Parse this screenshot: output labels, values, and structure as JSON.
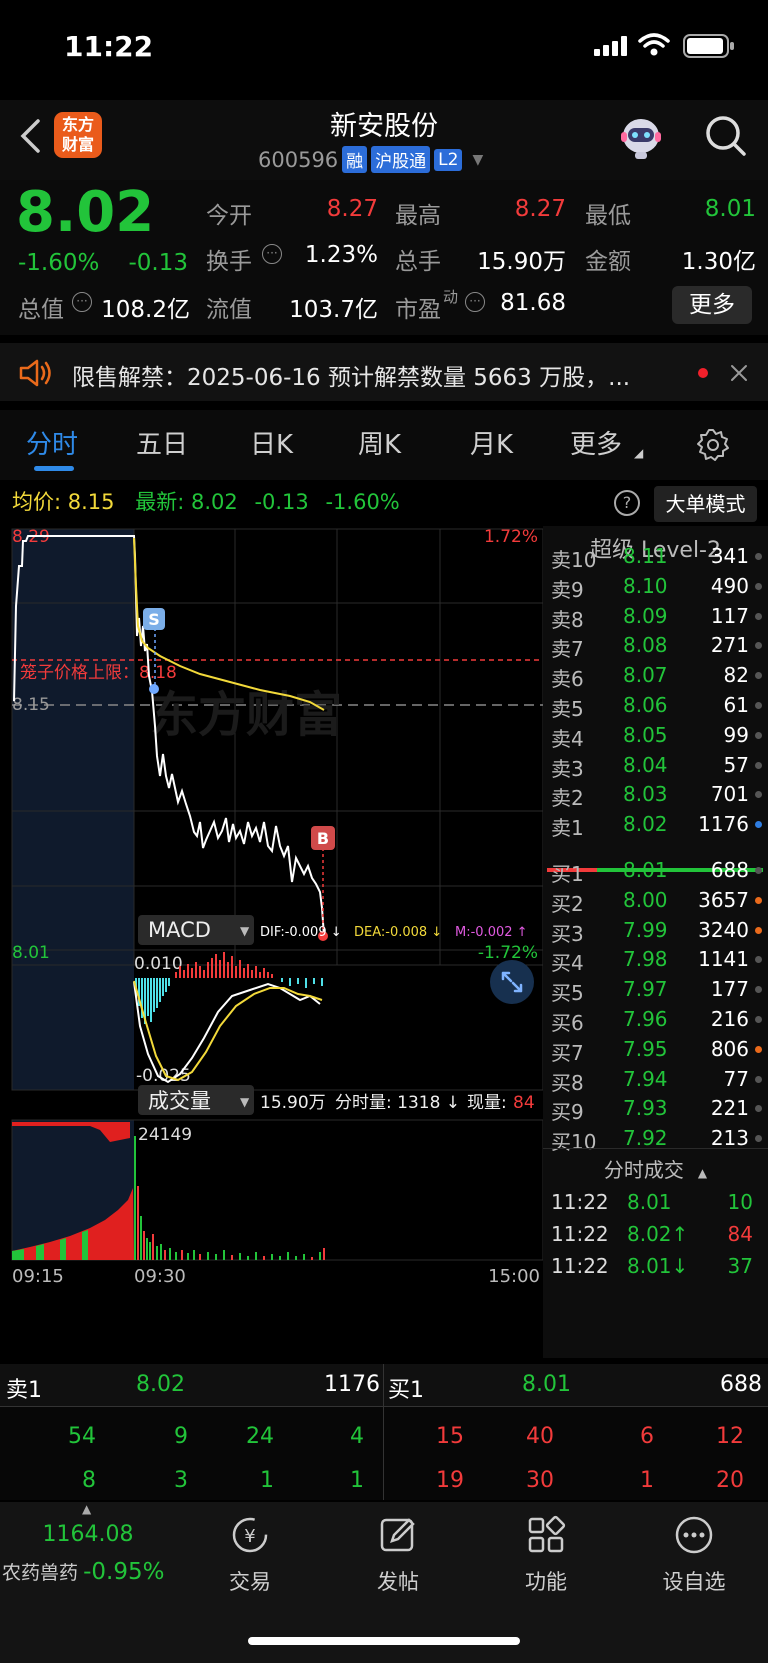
{
  "status_bar": {
    "time": "11:22"
  },
  "header": {
    "logo_line1": "东方",
    "logo_line2": "财富",
    "stock_name": "新安股份",
    "stock_code": "600596",
    "tags": [
      "融",
      "沪股通",
      "L2"
    ]
  },
  "quote": {
    "price": "8.02",
    "change_pct": "-1.60%",
    "change": "-0.13",
    "open_label": "今开",
    "open": "8.27",
    "high_label": "最高",
    "high": "8.27",
    "low_label": "最低",
    "low": "8.01",
    "turnover_label": "换手",
    "turnover": "1.23%",
    "volume_label": "总手",
    "volume": "15.90万",
    "amount_label": "金额",
    "amount": "1.30亿",
    "mktcap_label": "总值",
    "mktcap": "108.2亿",
    "float_label": "流值",
    "float_cap": "103.7亿",
    "pe_label": "市盈",
    "pe_sup": "动",
    "pe": "81.68",
    "more": "更多"
  },
  "notice": {
    "text": "限售解禁：2025-06-16 预计解禁数量 5663 万股，..."
  },
  "tabs": [
    "分时",
    "五日",
    "日K",
    "周K",
    "月K",
    "更多"
  ],
  "price_line": {
    "avg_label": "均价:",
    "avg": "8.15",
    "latest_label": "最新:",
    "latest": "8.02",
    "change": "-0.13",
    "change_pct": "-1.60%",
    "big_order": "大单模式"
  },
  "chart": {
    "y_top": "8.29",
    "y_ref": "8.15",
    "y_bottom": "8.01",
    "pct_top": "1.72%",
    "pct_bottom": "-1.72%",
    "cage_label": "笼子价格上限：8.18",
    "watermark": "东方财富",
    "sell_marker": "S",
    "buy_marker": "B",
    "macd_label": "MACD",
    "dif": "DIF:-0.009 ↓",
    "dea": "DEA:-0.008 ↓",
    "m": "M:-0.002 ↑",
    "macd_top": "0.010",
    "macd_bottom": "-0.025",
    "vol_label": "成交量",
    "vol_total": "15.90万",
    "vol_minute": "分时量: 1318 ↓",
    "vol_now_label": "现量:",
    "vol_now": "84",
    "vol_max": "24149",
    "time_start": "09:15",
    "time_open": "09:30",
    "time_end": "15:00"
  },
  "order_book": {
    "title": "超级 Level-2",
    "asks": [
      {
        "label": "卖10",
        "price": "8.11",
        "vol": "341"
      },
      {
        "label": "卖9",
        "price": "8.10",
        "vol": "490"
      },
      {
        "label": "卖8",
        "price": "8.09",
        "vol": "117"
      },
      {
        "label": "卖7",
        "price": "8.08",
        "vol": "271"
      },
      {
        "label": "卖6",
        "price": "8.07",
        "vol": "82"
      },
      {
        "label": "卖5",
        "price": "8.06",
        "vol": "61"
      },
      {
        "label": "卖4",
        "price": "8.05",
        "vol": "99"
      },
      {
        "label": "卖3",
        "price": "8.04",
        "vol": "57"
      },
      {
        "label": "卖2",
        "price": "8.03",
        "vol": "701"
      },
      {
        "label": "卖1",
        "price": "8.02",
        "vol": "1176"
      }
    ],
    "bids": [
      {
        "label": "买1",
        "price": "8.01",
        "vol": "688"
      },
      {
        "label": "买2",
        "price": "8.00",
        "vol": "3657"
      },
      {
        "label": "买3",
        "price": "7.99",
        "vol": "3240"
      },
      {
        "label": "买4",
        "price": "7.98",
        "vol": "1141"
      },
      {
        "label": "买5",
        "price": "7.97",
        "vol": "177"
      },
      {
        "label": "买6",
        "price": "7.96",
        "vol": "216"
      },
      {
        "label": "买7",
        "price": "7.95",
        "vol": "806"
      },
      {
        "label": "买8",
        "price": "7.94",
        "vol": "77"
      },
      {
        "label": "买9",
        "price": "7.93",
        "vol": "221"
      },
      {
        "label": "买10",
        "price": "7.92",
        "vol": "213"
      }
    ],
    "ticks_title": "分时成交",
    "ticks": [
      {
        "time": "11:22",
        "price": "8.01",
        "vol": "10"
      },
      {
        "time": "11:22",
        "price": "8.02↑",
        "vol": "84"
      },
      {
        "time": "11:22",
        "price": "8.01↓",
        "vol": "37"
      }
    ]
  },
  "bottom_book": {
    "sell_label": "卖1",
    "sell_price": "8.02",
    "sell_vol": "1176",
    "buy_label": "买1",
    "buy_price": "8.01",
    "buy_vol": "688",
    "sell_q1": [
      "54",
      "9",
      "24",
      "4"
    ],
    "sell_q2": [
      "8",
      "3",
      "1",
      "1"
    ],
    "buy_q1": [
      "15",
      "40",
      "6",
      "12"
    ],
    "buy_q2": [
      "19",
      "30",
      "1",
      "20"
    ]
  },
  "nav": {
    "index_value": "1164.08",
    "index_name": "农药兽药",
    "index_change": "-0.95%",
    "items": [
      "交易",
      "发帖",
      "功能",
      "设自选"
    ]
  },
  "colors": {
    "up": "#f23b3b",
    "down": "#22c43a",
    "avg_line": "#f2d93a",
    "accent": "#2f7de1"
  }
}
